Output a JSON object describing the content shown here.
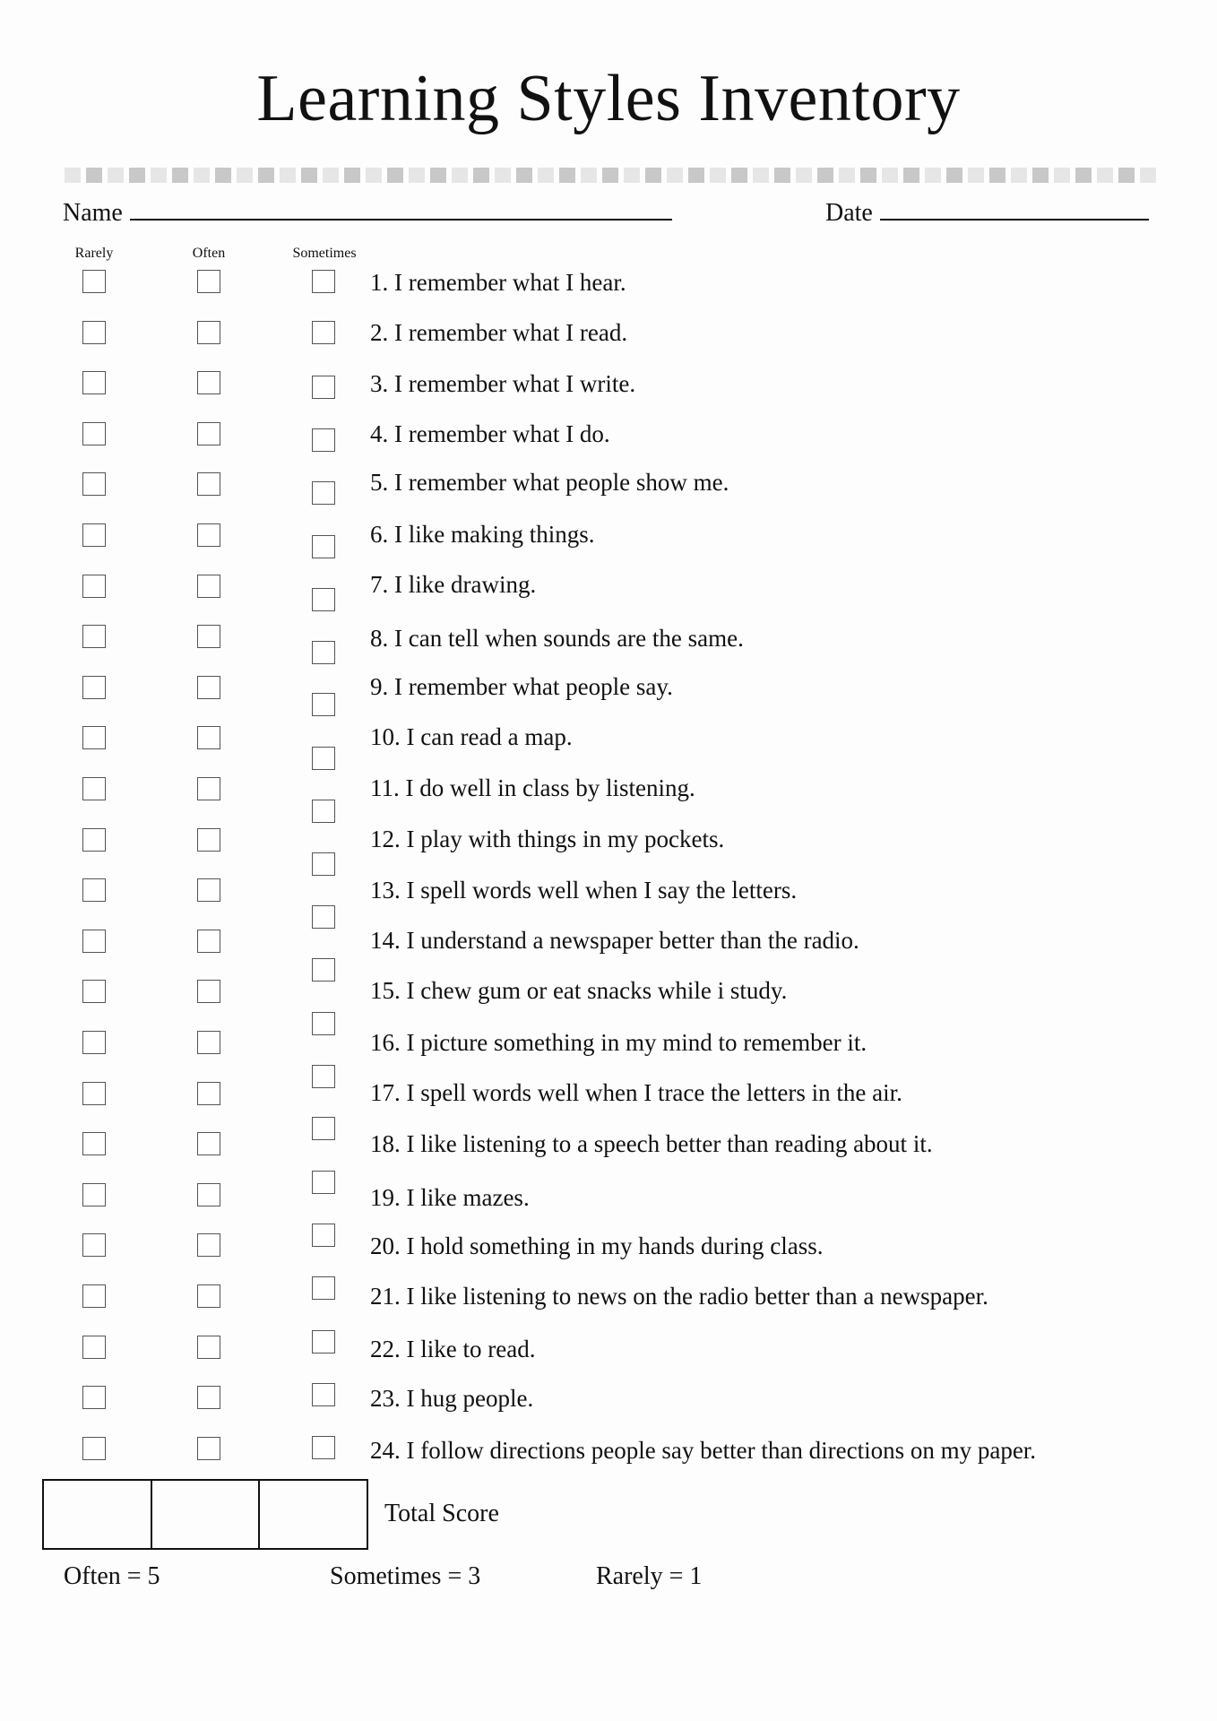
{
  "title": "Learning Styles Inventory",
  "fields": {
    "name_label": "Name",
    "date_label": "Date"
  },
  "columns": {
    "rarely": "Rarely",
    "often": "Often",
    "sometimes": "Sometimes"
  },
  "items": [
    "1. I remember what I hear.",
    "2. I remember what I read.",
    "3. I remember what I write.",
    "4. I remember what I do.",
    "5. I remember what people show me.",
    "6. I like making things.",
    "7. I like drawing.",
    "8. I can tell when sounds are the same.",
    "9. I remember what people say.",
    "10. I can read a map.",
    "11. I do well in class by listening.",
    "12. I play with things in my pockets.",
    "13. I spell words well when I say the letters.",
    "14. I understand a newspaper better than the radio.",
    "15. I chew gum or eat snacks while i study.",
    "16. I picture something in my mind to remember it.",
    "17. I spell words well when I trace the letters in the air.",
    "18. I like listening to a speech better than reading about it.",
    "19. I like mazes.",
    "20. I hold something in my hands during class.",
    "21. I like listening to news on the radio better than a newspaper.",
    "22. I like to read.",
    "23. I hug people.",
    "24. I follow directions people say better than directions on my paper."
  ],
  "score": {
    "label": "Total Score"
  },
  "legend": {
    "often": "Often = 5",
    "sometimes": "Sometimes = 3",
    "rarely": "Rarely = 1"
  },
  "colors": {
    "bar_light": "#e6e6e6",
    "bar_dark": "#c8c8c8",
    "checkbox_border": "#555555"
  }
}
